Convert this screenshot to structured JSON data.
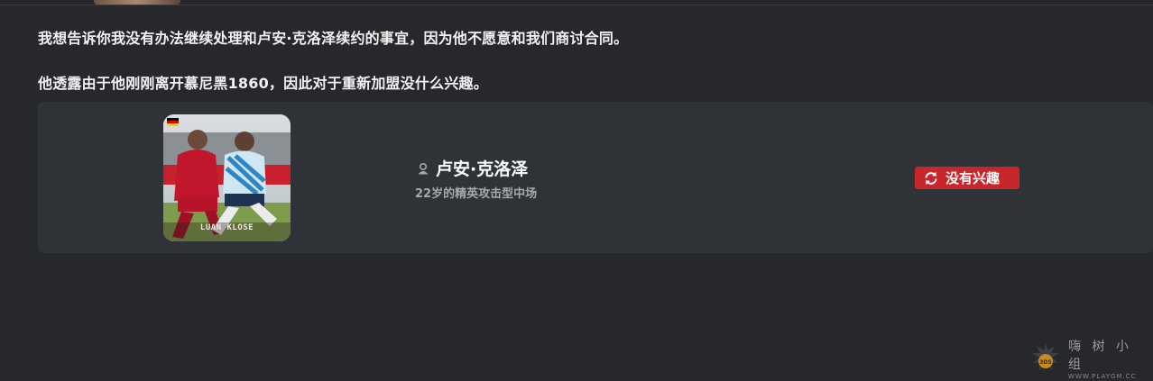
{
  "messages": [
    "我想告诉你我没有办法继续处理和卢安·克洛泽续约的事宜，因为他不愿意和我们商讨合同。",
    "他透露由于他刚刚离开慕尼黑1860，因此对于重新加盟没什么兴趣。"
  ],
  "player": {
    "name": "卢安·克洛泽",
    "description": "22岁的精英攻击型中场",
    "photo_caption": "LUAN KLOSE",
    "status_label": "没有兴趣"
  },
  "watermark": {
    "brand": "嗨 树 小 组",
    "url": "WWW.PLAYGM.CC"
  },
  "colors": {
    "background": "#26282c",
    "card": "#2f3237",
    "status_red": "#c9262b",
    "subtext": "#a5a8ad"
  },
  "icons": {
    "player": "person-icon",
    "status": "refresh-icon",
    "flag": "germany-flag-icon"
  }
}
